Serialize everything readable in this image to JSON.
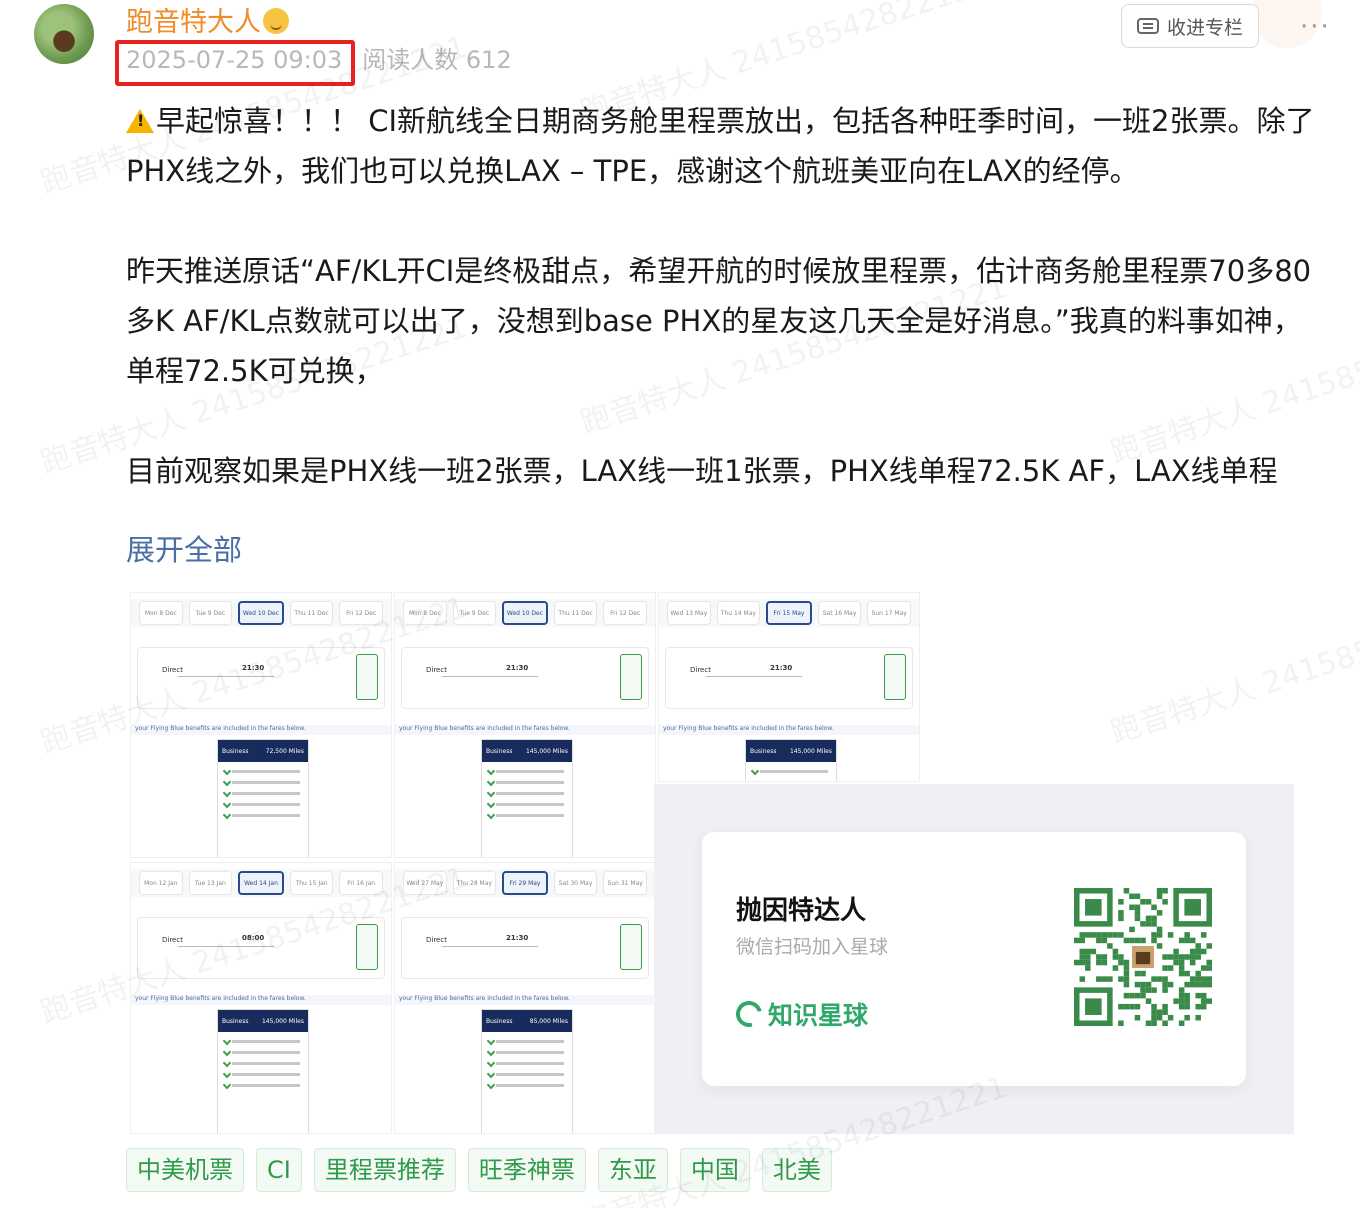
{
  "post": {
    "author": "跑音特大人",
    "date": "2025-07-25 09:03",
    "reads_label": "阅读人数 612",
    "collect_label": "收进专栏",
    "more_label": "···",
    "paragraphs": [
      "早起惊喜！！！ CI新航线全日期商务舱里程票放出，包括各种旺季时间，一班2张票。除了PHX线之外，我们也可以兑换LAX – TPE，感谢这个航班美亚向在LAX的经停。",
      "昨天推送原话“AF/KL开CI是终极甜点，希望开航的时候放里程票，估计商务舱里程票70多80多K AF/KL点数就可以出了，没想到base PHX的星友这几天全是好消息。”我真的料事如神，单程72.5K可兑换，",
      "目前观察如果是PHX线一班2张票，LAX线一班1张票，PHX线单程72.5K AF，LAX线单程"
    ],
    "expand_label": "展开全部"
  },
  "screenshots": [
    {
      "tabs": [
        "Mon 8 Dec",
        "Tue 9 Dec",
        "Wed 10 Dec",
        "Thu 11 Dec",
        "Fri 12 Dec"
      ],
      "selected": 2,
      "time": "21:30",
      "direct": "Direct",
      "note": "your Flying Blue benefits are included in the fares below.",
      "card_title": "Business",
      "card_miles": "72,500 Miles"
    },
    {
      "tabs": [
        "Mon 8 Dec",
        "Tue 9 Dec",
        "Wed 10 Dec",
        "Thu 11 Dec",
        "Fri 12 Dec"
      ],
      "selected": 2,
      "time": "21:30",
      "direct": "Direct",
      "note": "your Flying Blue benefits are included in the fares below.",
      "card_title": "Business",
      "card_miles": "145,000 Miles"
    },
    {
      "tabs": [
        "Wed 13 May",
        "Thu 14 May",
        "Fri 15 May",
        "Sat 16 May",
        "Sun 17 May"
      ],
      "selected": 2,
      "time": "21:30",
      "direct": "Direct",
      "note": "your Flying Blue benefits are included in the fares below.",
      "card_title": "Business",
      "card_miles": "145,000 Miles"
    },
    {
      "tabs": [
        "Mon 12 Jan",
        "Tue 13 Jan",
        "Wed 14 Jan",
        "Thu 15 Jan",
        "Fri 16 Jan"
      ],
      "selected": 2,
      "time": "08:00",
      "direct": "Direct",
      "note": "your Flying Blue benefits are included in the fares below.",
      "card_title": "Business",
      "card_miles": "145,000 Miles"
    },
    {
      "tabs": [
        "Wed 27 May",
        "Thu 28 May",
        "Fri 29 May",
        "Sat 30 May",
        "Sun 31 May"
      ],
      "selected": 2,
      "time": "21:30",
      "direct": "Direct",
      "note": "your Flying Blue benefits are included in the fares below.",
      "card_title": "Business",
      "card_miles": "85,000 Miles"
    }
  ],
  "qr_card": {
    "title": "抛因特达人",
    "subtitle": "微信扫码加入星球",
    "brand": "知识星球"
  },
  "tags": [
    "中美机票",
    "CI",
    "里程票推荐",
    "旺季神票",
    "东亚",
    "中国",
    "北美"
  ],
  "watermark": "跑音特大人 2415854282​21221",
  "colors": {
    "author": "#f08c28",
    "highlight_box": "#e8231f",
    "tag_green": "#2f9a4a",
    "link_blue": "#4a6fa5"
  }
}
